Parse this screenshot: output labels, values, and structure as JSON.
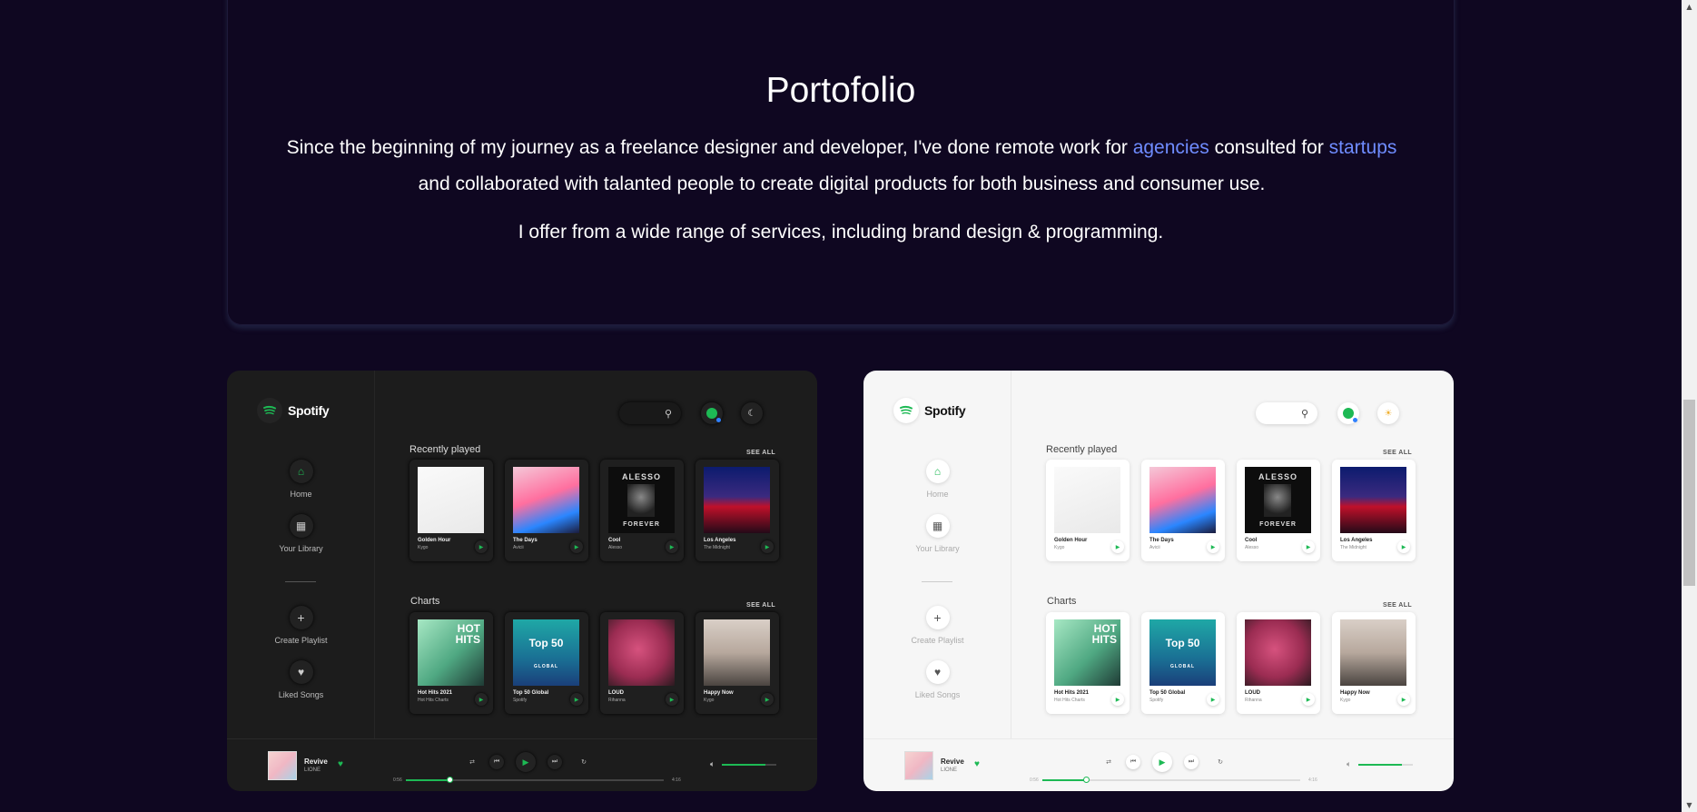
{
  "intro": {
    "title": "Portofolio",
    "para_part1": "Since the beginning of my journey as a freelance designer and developer, I've done remote work for ",
    "link_agencies": "agencies",
    "para_part2": " consulted for ",
    "link_startups": "startups",
    "para_part3": " and collaborated with talanted people to create digital products for both business and consumer use.",
    "para2": "I offer from a wide range of services, including brand design & programming."
  },
  "app": {
    "brand": "Spotify",
    "nav": {
      "home": "Home",
      "library": "Your Library",
      "create": "Create Playlist",
      "liked": "Liked Songs"
    },
    "recent_title": "Recently played",
    "charts_title": "Charts",
    "see_all": "SEE ALL",
    "recent": [
      {
        "title": "Golden Hour",
        "artist": "Kygo"
      },
      {
        "title": "The Days",
        "artist": "Avicii"
      },
      {
        "title": "Cool",
        "artist": "Alesso"
      },
      {
        "title": "Los Angeles",
        "artist": "The Midnight"
      }
    ],
    "charts": [
      {
        "title": "Hot Hits 2021",
        "artist": "Hot Hits Charts"
      },
      {
        "title": "Top 50 Global",
        "artist": "Spotify"
      },
      {
        "title": "LOUD",
        "artist": "Rihanna"
      },
      {
        "title": "Happy Now",
        "artist": "Kygo"
      }
    ],
    "cover_text": {
      "alesso": "ALESSO",
      "forever": "FOREVER",
      "hot": "HOT",
      "hits": "HITS",
      "top50": "Top 50",
      "global": "GLOBAL"
    },
    "player": {
      "title": "Revive",
      "artist": "LIONE",
      "time_elapsed": "0:56",
      "time_total": "4:16",
      "progress": 0.17,
      "volume": 0.8
    }
  },
  "colors": {
    "accent": "#1db954",
    "link": "#6f8cff",
    "background": "#0f0721"
  }
}
